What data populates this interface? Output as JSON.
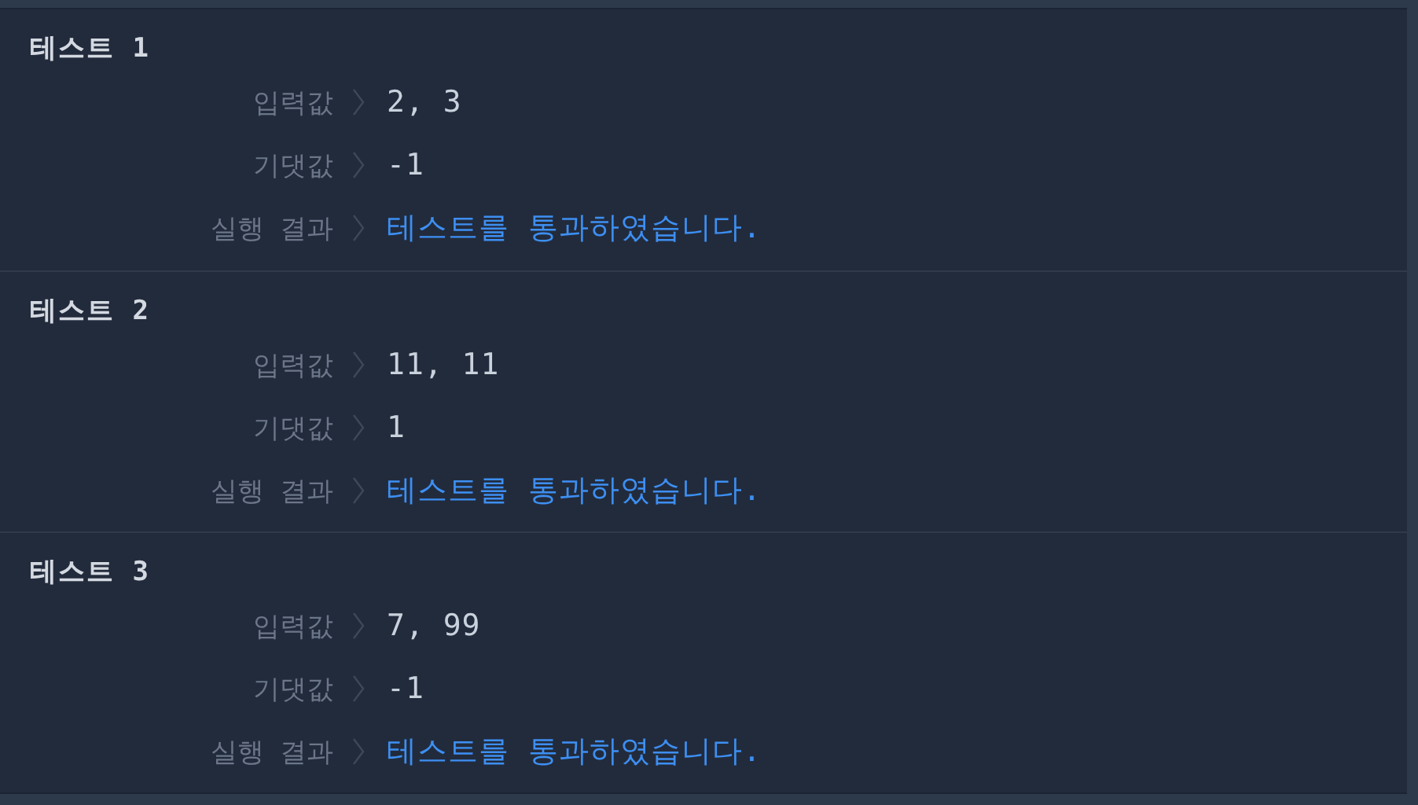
{
  "tests": [
    {
      "title": "테스트 1",
      "rows": [
        {
          "kind": "value",
          "label": "입력값",
          "value": "2, 3"
        },
        {
          "kind": "value",
          "label": "기댓값",
          "value": "-1"
        },
        {
          "kind": "result",
          "label": "실행 결과",
          "value": "테스트를 통과하였습니다.",
          "passed": true
        }
      ]
    },
    {
      "title": "테스트 2",
      "rows": [
        {
          "kind": "value",
          "label": "입력값",
          "value": "11, 11"
        },
        {
          "kind": "value",
          "label": "기댓값",
          "value": "1"
        },
        {
          "kind": "result",
          "label": "실행 결과",
          "value": "테스트를 통과하였습니다.",
          "passed": true
        }
      ]
    },
    {
      "title": "테스트 3",
      "rows": [
        {
          "kind": "value",
          "label": "입력값",
          "value": "7, 99"
        },
        {
          "kind": "value",
          "label": "기댓값",
          "value": "-1"
        },
        {
          "kind": "result",
          "label": "실행 결과",
          "value": "테스트를 통과하였습니다.",
          "passed": true
        }
      ]
    }
  ]
}
